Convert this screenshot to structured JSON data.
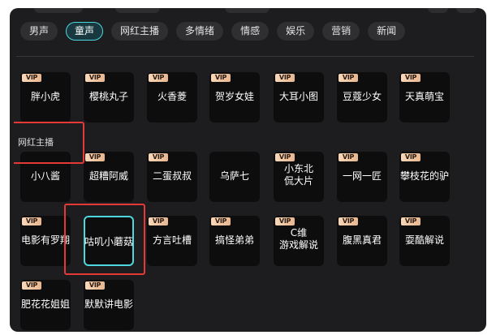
{
  "tabs": [
    {
      "label": "男声",
      "active": false
    },
    {
      "label": "童声",
      "active": true
    },
    {
      "label": "网红主播",
      "active": false
    },
    {
      "label": "多情绪",
      "active": false
    },
    {
      "label": "情感",
      "active": false
    },
    {
      "label": "娱乐",
      "active": false
    },
    {
      "label": "营销",
      "active": false
    },
    {
      "label": "新闻",
      "active": false
    }
  ],
  "section_label": "网红主播",
  "vip_badge": "VIP",
  "voices": [
    {
      "name": "胖小虎",
      "vip": true
    },
    {
      "name": "樱桃丸子",
      "vip": true
    },
    {
      "name": "火香菱",
      "vip": true
    },
    {
      "name": "贺岁女娃",
      "vip": true
    },
    {
      "name": "大耳小图",
      "vip": true
    },
    {
      "name": "豆蔻少女",
      "vip": true
    },
    {
      "name": "天真萌宝",
      "vip": true
    },
    {
      "name": "小八酱",
      "vip": false
    },
    {
      "name": "超糟阿威",
      "vip": true
    },
    {
      "name": "二蛋叔叔",
      "vip": true
    },
    {
      "name": "乌萨七",
      "vip": false
    },
    {
      "name": "小东北\n侃大片",
      "vip": true
    },
    {
      "name": "一网一匠",
      "vip": true
    },
    {
      "name": "攀枝花的驴",
      "vip": true
    },
    {
      "name": "电影有罗翔",
      "vip": true
    },
    {
      "name": "咕叽小蘑菇",
      "vip": false,
      "selected": true
    },
    {
      "name": "方言吐槽",
      "vip": true
    },
    {
      "name": "搞怪弟弟",
      "vip": true
    },
    {
      "name": "C维\n游戏解说",
      "vip": true
    },
    {
      "name": "腹黑真君",
      "vip": true
    },
    {
      "name": "耍酷解说",
      "vip": true
    },
    {
      "name": "肥花花姐姐",
      "vip": true
    },
    {
      "name": "默默讲电影",
      "vip": true
    }
  ]
}
